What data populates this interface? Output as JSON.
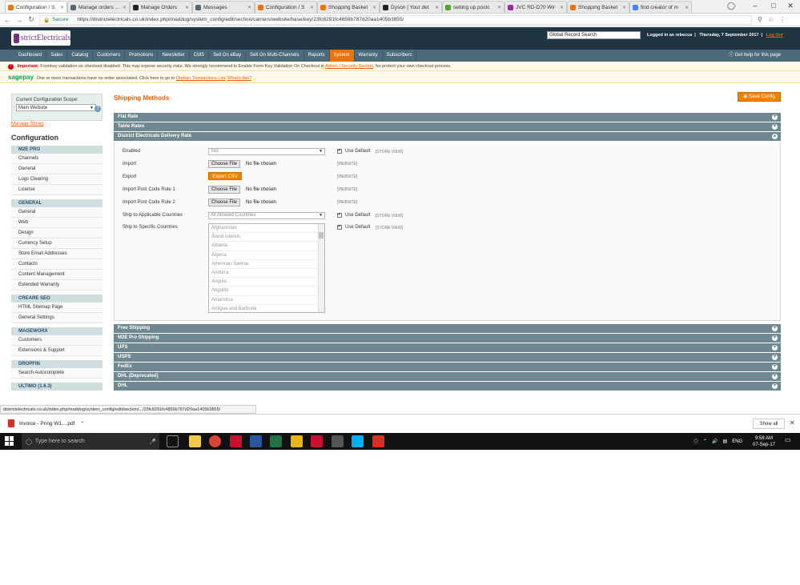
{
  "browser": {
    "tabs": [
      {
        "label": "Configuration / S",
        "color": "#e8740d",
        "active": true
      },
      {
        "label": "Manage orders ...",
        "color": "#5b6770",
        "active": false
      },
      {
        "label": "Manage Orders",
        "color": "#222222",
        "active": false
      },
      {
        "label": "Messages",
        "color": "#5b6770",
        "active": false
      },
      {
        "label": "Configuration / S",
        "color": "#e8740d",
        "active": false
      },
      {
        "label": "Shopping Basket",
        "color": "#e8740d",
        "active": false
      },
      {
        "label": "Dyson | Your det",
        "color": "#222222",
        "active": false
      },
      {
        "label": "setting up postc",
        "color": "#55a630",
        "active": false
      },
      {
        "label": "JVC RD-D70 Wir",
        "color": "#9c27b0",
        "active": false
      },
      {
        "label": "Shopping Basket",
        "color": "#e8740d",
        "active": false
      },
      {
        "label": "find creator of m",
        "color": "#4285f4",
        "active": false
      }
    ],
    "secure_label": "Secure",
    "url": "https://districtelectricals.co.uk/index.php/maddog/system_config/edit/section/carriers/website/base/key/23fc8291fc4859b787d20aa1405b3855/"
  },
  "header": {
    "logo_text": "strictElectricals",
    "search_value": "Global Record Search",
    "logged_in": "Logged in as rebecca",
    "date": "Thursday, 7 September 2017",
    "logout": "Log Out"
  },
  "nav": {
    "items": [
      "Dashboard",
      "Sales",
      "Catalog",
      "Customers",
      "Promotions",
      "Newsletter",
      "CMS",
      "Sell On eBay",
      "Sell On Multi-Channels",
      "Reports",
      "System",
      "Warranty",
      "Subscribers"
    ],
    "active": "System",
    "help": "Get help for this page"
  },
  "notices": {
    "important_label": "Important:",
    "important_text": "Formkey validation on checkout disabled. This may expose security risks. We strongly recommend to Enable Form Key Validation On Checkout in",
    "important_link": "Admin / Security Section",
    "important_tail": ", for protect your own checkout process.",
    "sage_logo": "sagepay",
    "sage_text": "One or more transactions have no order associated. Click here to go to",
    "sage_link1": "Orphan Transactions List",
    "sage_link2": "What's this?"
  },
  "sidebar": {
    "scope_label": "Current Configuration Scope:",
    "scope_value": "Main Website",
    "manage_stores": "Manage Stores",
    "title": "Configuration",
    "groups": [
      {
        "name": "M2E PRO",
        "items": [
          "Channels",
          "General",
          "Logs Clearing",
          "License"
        ]
      },
      {
        "name": "GENERAL",
        "items": [
          "General",
          "Web",
          "Design",
          "Currency Setup",
          "Store Email Addresses",
          "Contacts",
          "Content Management",
          "Extended Warranty"
        ]
      },
      {
        "name": "CREARE SEO",
        "items": [
          "HTML Sitemap Page",
          "General Settings"
        ]
      },
      {
        "name": "MAGEWORX",
        "items": [
          "Customers",
          "Extensions & Support"
        ]
      },
      {
        "name": "DROPFIN",
        "items": [
          "Search Autocomplete"
        ]
      },
      {
        "name": "ULTIMO (1.6.3)",
        "items": []
      }
    ]
  },
  "main": {
    "title": "Shipping Methods",
    "save_button": "Save Config",
    "sections_top": [
      "Flat Rate",
      "Table Rates",
      "District Electricals Delivery Rate"
    ],
    "sections_bottom": [
      "Free Shipping",
      "M2E Pro Shipping",
      "UPS",
      "USPS",
      "FedEx",
      "DHL (Deprecated)",
      "DHL"
    ],
    "fields": {
      "enabled_label": "Enabled",
      "enabled_value": "Yes",
      "import_label": "Import",
      "export_label": "Export",
      "export_button": "Export CSV",
      "rule1_label": "Import Post Code Rule 1",
      "rule2_label": "Import Post Code Rule 2",
      "choose_file": "Choose File",
      "no_file": "No file chosen",
      "applicable_label": "Ship to Applicable Countries",
      "applicable_value": "All Allowed Countries",
      "specific_label": "Ship to Specific Countries",
      "use_default": "Use Default",
      "store_view": "[STORE VIEW]",
      "website": "[WEBSITE]"
    },
    "countries": [
      "Afghanistan",
      "Åland Islands",
      "Albania",
      "Algeria",
      "American Samoa",
      "Andorra",
      "Angola",
      "Anguilla",
      "Antarctica",
      "Antigua and Barbuda"
    ]
  },
  "status_url": "districtelectricals.co.uk/index.php/maddog/system_config/edit/section/.../23fc8291fc4859b787d20aa1405b3855/",
  "download": {
    "file": "Invoice - Pring W1....pdf",
    "show_all": "Show all"
  },
  "taskbar": {
    "search_placeholder": "Type here to search",
    "lang": "ENG",
    "time": "9:58 AM",
    "date": "07-Sep-17"
  }
}
